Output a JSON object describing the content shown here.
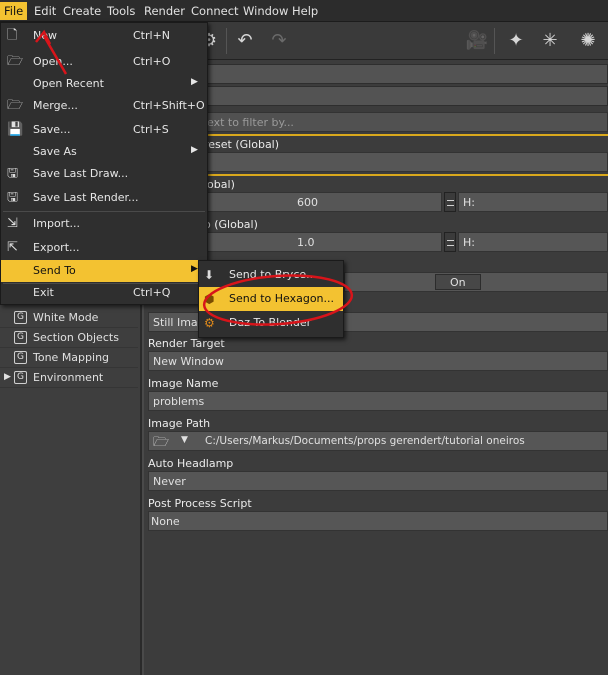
{
  "menubar": {
    "items": [
      "File",
      "Edit",
      "Create",
      "Tools",
      "Render",
      "Connect",
      "Window",
      "Help"
    ]
  },
  "file_menu": {
    "items": [
      {
        "label": "New",
        "shortcut": "Ctrl+N",
        "icon": "new-file-icon"
      },
      {
        "label": "Open...",
        "shortcut": "Ctrl+O",
        "icon": "open-folder-icon"
      },
      {
        "label": "Open Recent",
        "shortcut": "",
        "icon": ""
      },
      {
        "label": "Merge...",
        "shortcut": "Ctrl+Shift+O",
        "icon": "merge-icon"
      },
      {
        "label": "Save...",
        "shortcut": "Ctrl+S",
        "icon": "save-icon"
      },
      {
        "label": "Save As",
        "shortcut": "",
        "icon": ""
      },
      {
        "label": "Save Last Draw...",
        "shortcut": "",
        "icon": "save-draw-icon"
      },
      {
        "label": "Save Last Render...",
        "shortcut": "",
        "icon": "save-render-icon"
      },
      {
        "label": "Import...",
        "shortcut": "",
        "icon": "import-icon"
      },
      {
        "label": "Export...",
        "shortcut": "",
        "icon": "export-icon"
      },
      {
        "label": "Send To",
        "shortcut": "",
        "icon": ""
      },
      {
        "label": "Exit",
        "shortcut": "Ctrl+Q",
        "icon": ""
      }
    ]
  },
  "send_to_menu": {
    "items": [
      {
        "label": "Send to Bryce...",
        "icon": "bryce-icon"
      },
      {
        "label": "Send to Hexagon...",
        "icon": "hexagon-icon"
      },
      {
        "label": "Daz To Blender",
        "icon": "blender-icon"
      }
    ]
  },
  "left_panel": {
    "items": [
      {
        "label": "White Mode",
        "icon": "G"
      },
      {
        "label": "Section Objects",
        "icon": "G"
      },
      {
        "label": "Tone Mapping",
        "icon": "G"
      },
      {
        "label": "Environment",
        "icon": "G"
      }
    ]
  },
  "right_panel": {
    "filter_placeholder": "ext to filter by...",
    "preset_label": "reset (Global)",
    "dim_label": "lobal)",
    "dim_value": "600",
    "dim_h_label": "H:",
    "ratio_label": "o (Global)",
    "ratio_value": "1.0",
    "ratio_h_label": "H:",
    "toggle_label": "On",
    "render_type_value": "Still Image",
    "render_target_label": "Render Target",
    "render_target_value": "New Window",
    "image_name_label": "Image Name",
    "image_name_value": "problems",
    "image_path_label": "Image Path",
    "image_path_value": "C:/Users/Markus/Documents/props gerendert/tutorial oneiros",
    "auto_headlamp_label": "Auto Headlamp",
    "auto_headlamp_value": "Never",
    "post_process_label": "Post Process Script",
    "post_process_value": "None"
  },
  "colors": {
    "highlight": "#f3c231",
    "annotation": "#d8141a"
  }
}
